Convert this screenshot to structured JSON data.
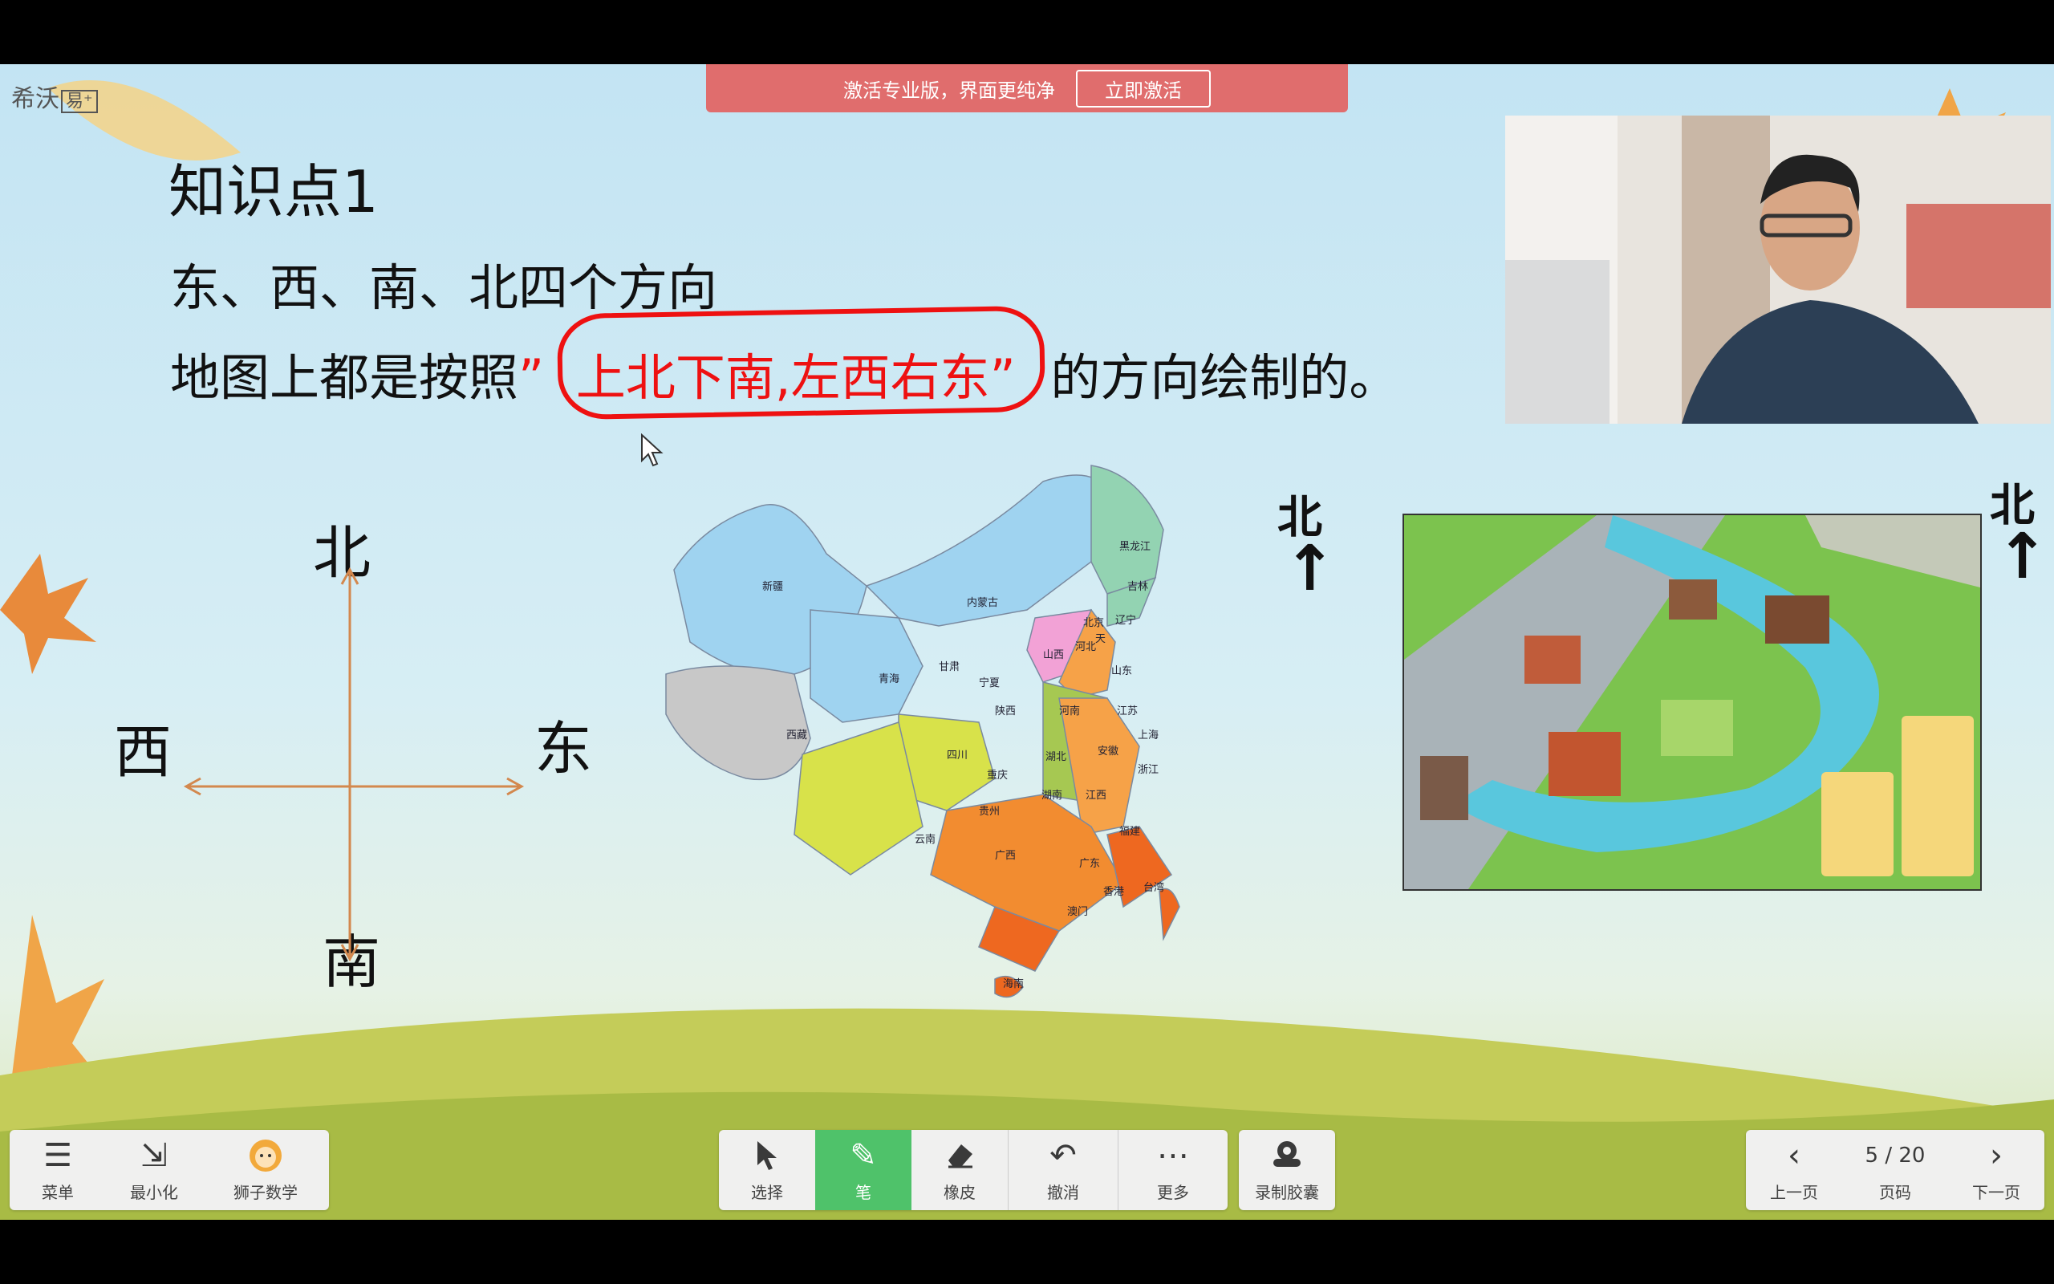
{
  "banner": {
    "text": "激活专业版，界面更纯净",
    "button": "立即激活"
  },
  "logo": {
    "text": "希沃",
    "suffix": "易⁺"
  },
  "lesson": {
    "title": "知识点1",
    "line1": "东、西、南、北四个方向",
    "line2_prefix": "地图上都是按照",
    "line2_quote_open": "”",
    "line2_highlight": "上北下南,左西右东",
    "line2_quote_close": "”",
    "line2_suffix": "的方向绘制的。"
  },
  "compass": {
    "north": "北",
    "south": "南",
    "east": "东",
    "west": "西"
  },
  "map_north": {
    "label": "北",
    "arrow": "↑"
  },
  "park_north": {
    "label": "北",
    "arrow": "↑"
  },
  "provinces": [
    "新疆",
    "西藏",
    "青海",
    "甘肃",
    "内蒙古",
    "宁夏",
    "陕西",
    "山西",
    "北京",
    "河北",
    "天",
    "黑龙江",
    "吉林",
    "辽宁",
    "山东",
    "河南",
    "江苏",
    "上海",
    "安徽",
    "浙江",
    "湖北",
    "四川",
    "重庆",
    "贵州",
    "云南",
    "湖南",
    "江西",
    "福建",
    "广西",
    "广东",
    "台湾",
    "香港",
    "澳门",
    "海南"
  ],
  "watermark": "狮子数学",
  "left_toolbar": [
    {
      "label": "菜单",
      "icon": "menu-icon"
    },
    {
      "label": "最小化",
      "icon": "minimize-icon"
    },
    {
      "label": "狮子数学",
      "icon": "lion-avatar-icon"
    }
  ],
  "center_toolbar": [
    {
      "label": "选择",
      "icon": "cursor-icon"
    },
    {
      "label": "笔",
      "icon": "pen-icon",
      "active": true
    },
    {
      "label": "橡皮",
      "icon": "eraser-icon"
    },
    {
      "label": "撤消",
      "icon": "undo-icon"
    },
    {
      "label": "更多",
      "icon": "more-icon"
    }
  ],
  "record_tool": {
    "label": "录制胶囊",
    "icon": "record-icon"
  },
  "pager": {
    "prev": "上一页",
    "page_label": "页码",
    "next": "下一页",
    "current": "5 / 20"
  },
  "colors": {
    "accent_green": "#4fc26a",
    "banner": "#e06d6d",
    "highlight_red": "#e11111"
  }
}
